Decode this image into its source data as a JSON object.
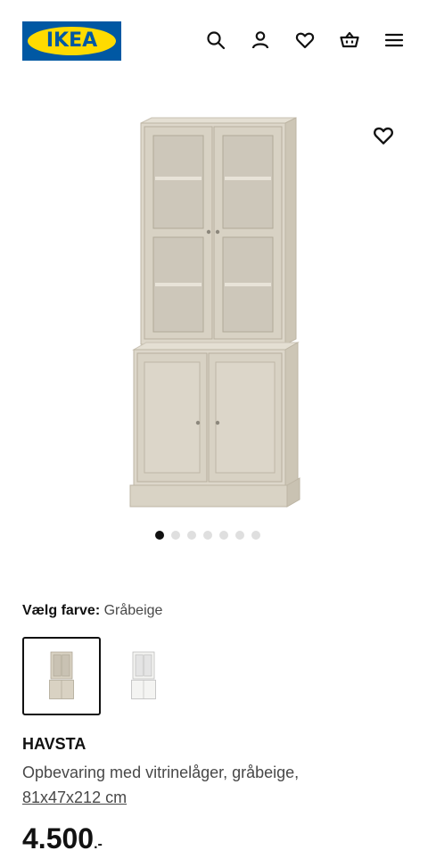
{
  "header": {
    "logo_text": "IKEA",
    "brand_colors": {
      "blue": "#0058a3",
      "yellow": "#ffdb00"
    },
    "icons": [
      "search-icon",
      "user-icon",
      "heart-icon",
      "basket-icon",
      "menu-icon"
    ]
  },
  "gallery": {
    "image_count": 7,
    "active_index": 0,
    "favorite_icon": "heart-icon"
  },
  "color_selector": {
    "label": "Vælg farve:",
    "value": "Gråbeige",
    "options": [
      {
        "name": "Gråbeige",
        "selected": true,
        "color": "#d9d2c3"
      },
      {
        "name": "Hvid",
        "selected": false,
        "color": "#f4f4f2"
      }
    ]
  },
  "product": {
    "name": "HAVSTA",
    "description": "Opbevaring med vitrinelåger, gråbeige,",
    "dimensions": "81x47x212 cm",
    "price_main": "4.500",
    "price_suffix": ".-"
  }
}
